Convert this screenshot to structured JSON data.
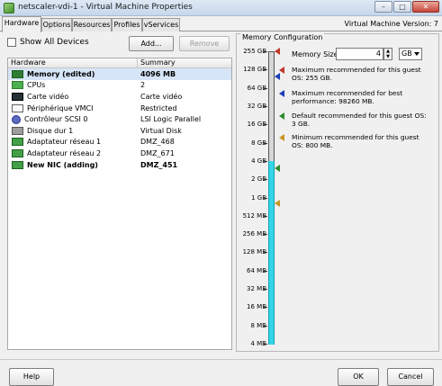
{
  "window": {
    "title": "netscaler-vdi-1 - Virtual Machine Properties",
    "controls": {
      "minimize": "–",
      "maximize": "□",
      "close": "✕"
    }
  },
  "tabs": [
    "Hardware",
    "Options",
    "Resources",
    "Profiles",
    "vServices"
  ],
  "active_tab": "Hardware",
  "vm_version": "Virtual Machine Version: 7",
  "hardware_panel": {
    "show_all_devices": "Show All Devices",
    "show_all_checked": false,
    "add_button": "Add...",
    "remove_button": "Remove",
    "columns": [
      "Hardware",
      "Summary"
    ],
    "rows": [
      {
        "name": "Memory (edited)",
        "summary": "4096 MB",
        "icon": "memory-icon",
        "bold": true,
        "selected": true
      },
      {
        "name": "CPUs",
        "summary": "2",
        "icon": "cpu-icon",
        "bold": false,
        "selected": false
      },
      {
        "name": "Carte vidéo",
        "summary": "Carte vidéo",
        "icon": "video-card-icon",
        "bold": false,
        "selected": false
      },
      {
        "name": "Périphérique VMCI",
        "summary": "Restricted",
        "icon": "vmci-device-icon",
        "bold": false,
        "selected": false
      },
      {
        "name": "Contrôleur SCSI 0",
        "summary": "LSI Logic Parallel",
        "icon": "scsi-controller-icon",
        "bold": false,
        "selected": false
      },
      {
        "name": "Disque dur 1",
        "summary": "Virtual Disk",
        "icon": "hard-disk-icon",
        "bold": false,
        "selected": false
      },
      {
        "name": "Adaptateur réseau 1",
        "summary": "DMZ_468",
        "icon": "network-adapter-icon",
        "bold": false,
        "selected": false
      },
      {
        "name": "Adaptateur réseau 2",
        "summary": "DMZ_671",
        "icon": "network-adapter-icon",
        "bold": false,
        "selected": false
      },
      {
        "name": "New NIC (adding)",
        "summary": "DMZ_451",
        "icon": "network-adapter-icon",
        "bold": true,
        "selected": false
      }
    ]
  },
  "memory_config": {
    "group_title": "Memory Configuration",
    "size_label": "Memory Size:",
    "size_value": "4",
    "unit": "GB",
    "scale_labels": [
      "255 GB",
      "128 GB",
      "64 GB",
      "32 GB",
      "16 GB",
      "8 GB",
      "4 GB",
      "2 GB",
      "1 GB",
      "512 MB",
      "256 MB",
      "128 MB",
      "64 MB",
      "32 MB",
      "16 MB",
      "8 MB",
      "4 MB"
    ],
    "current_level_index": 6,
    "legend": [
      {
        "text": "Maximum recommended for this guest OS: 255 GB.",
        "color": "#c0392b",
        "scale_index": 0
      },
      {
        "text": "Maximum recommended for best performance: 98260 MB.",
        "color": "#1a3fb8",
        "scale_index": 1.4
      },
      {
        "text": "Default recommended for this guest OS: 3 GB.",
        "color": "#2e8b2e",
        "scale_index": 6.4
      },
      {
        "text": "Minimum recommended for this guest OS: 800 MB.",
        "color": "#c8962a",
        "scale_index": 8.3
      }
    ]
  },
  "footer": {
    "help": "Help",
    "ok": "OK",
    "cancel": "Cancel"
  }
}
